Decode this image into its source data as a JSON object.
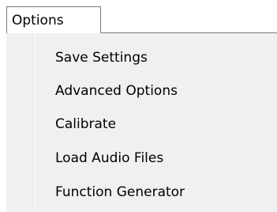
{
  "menu": {
    "title": "Options",
    "items": [
      {
        "label": "Save Settings"
      },
      {
        "label": "Advanced Options"
      },
      {
        "label": "Calibrate"
      },
      {
        "label": "Load Audio Files"
      },
      {
        "label": "Function Generator"
      }
    ]
  }
}
